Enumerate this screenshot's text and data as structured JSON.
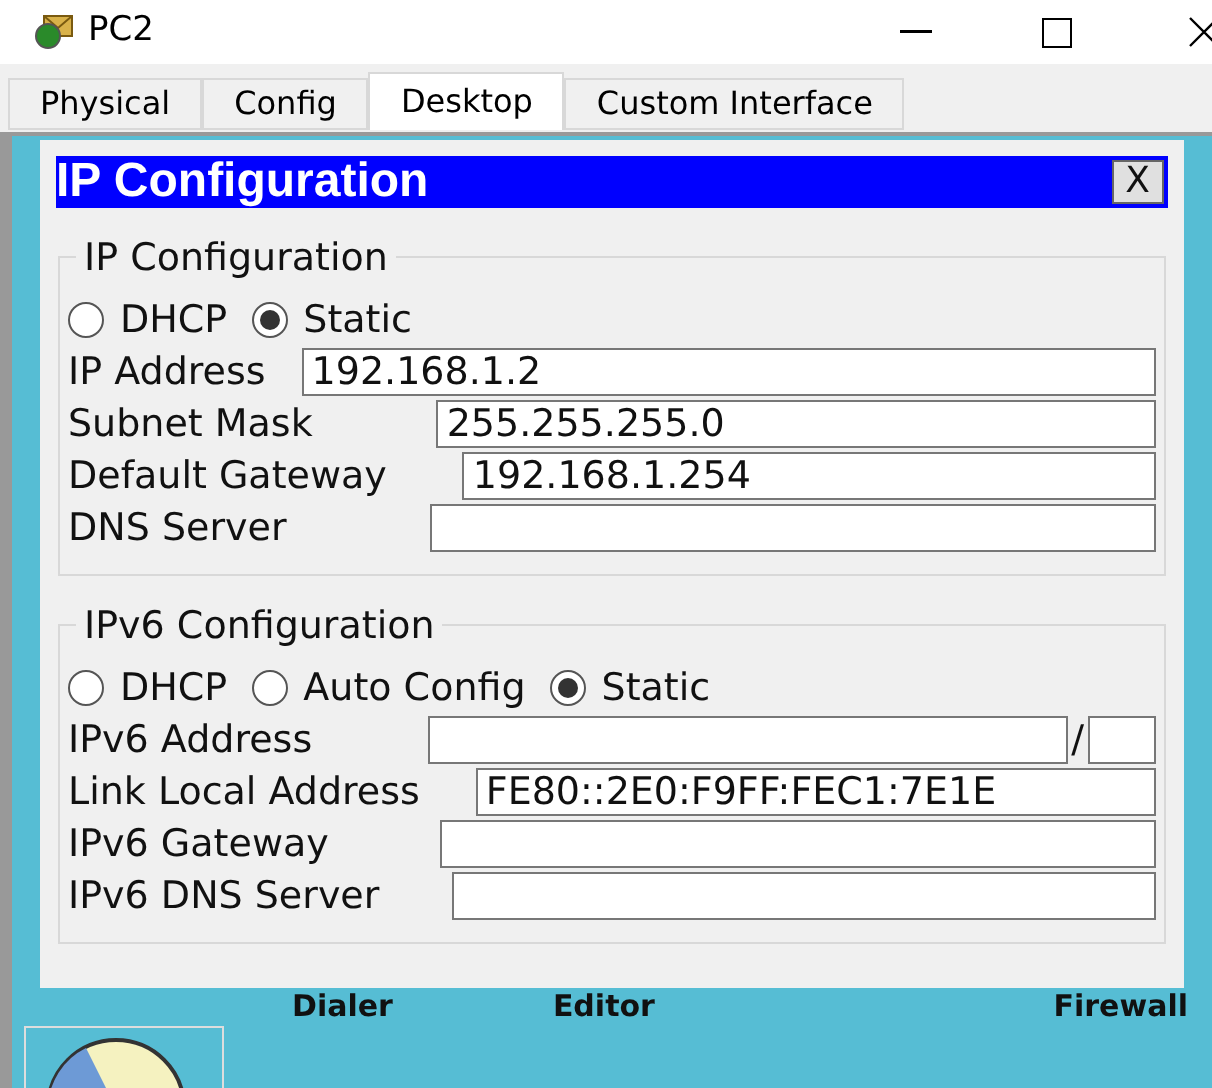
{
  "window": {
    "title": "PC2"
  },
  "tabs": [
    {
      "label": "Physical",
      "selected": false
    },
    {
      "label": "Config",
      "selected": false
    },
    {
      "label": "Desktop",
      "selected": true
    },
    {
      "label": "Custom Interface",
      "selected": false
    }
  ],
  "dialog": {
    "title": "IP Configuration",
    "close": "X",
    "ipv4": {
      "legend": "IP Configuration",
      "modes": [
        {
          "label": "DHCP",
          "selected": false
        },
        {
          "label": "Static",
          "selected": true
        }
      ],
      "fields": [
        {
          "label": "IP Address",
          "value": "192.168.1.2"
        },
        {
          "label": "Subnet Mask",
          "value": "255.255.255.0"
        },
        {
          "label": "Default Gateway",
          "value": "192.168.1.254"
        },
        {
          "label": "DNS Server"
        }
      ]
    },
    "ipv6": {
      "legend": "IPv6 Configuration",
      "modes": [
        {
          "label": "DHCP",
          "selected": false
        },
        {
          "label": "Auto Config",
          "selected": false
        },
        {
          "label": "Static",
          "selected": true
        }
      ],
      "fields": [
        {
          "label": "IPv6 Address",
          "kind": "prefixed",
          "separator": "/"
        },
        {
          "label": "Link Local Address",
          "value": "FE80::2E0:F9FF:FEC1:7E1E",
          "kind": "plain"
        },
        {
          "label": "IPv6 Gateway",
          "kind": "plain"
        },
        {
          "label": "IPv6 DNS Server",
          "kind": "plain"
        }
      ]
    }
  },
  "desktop_apps": [
    "Dialer",
    "Editor",
    "Firewall"
  ]
}
